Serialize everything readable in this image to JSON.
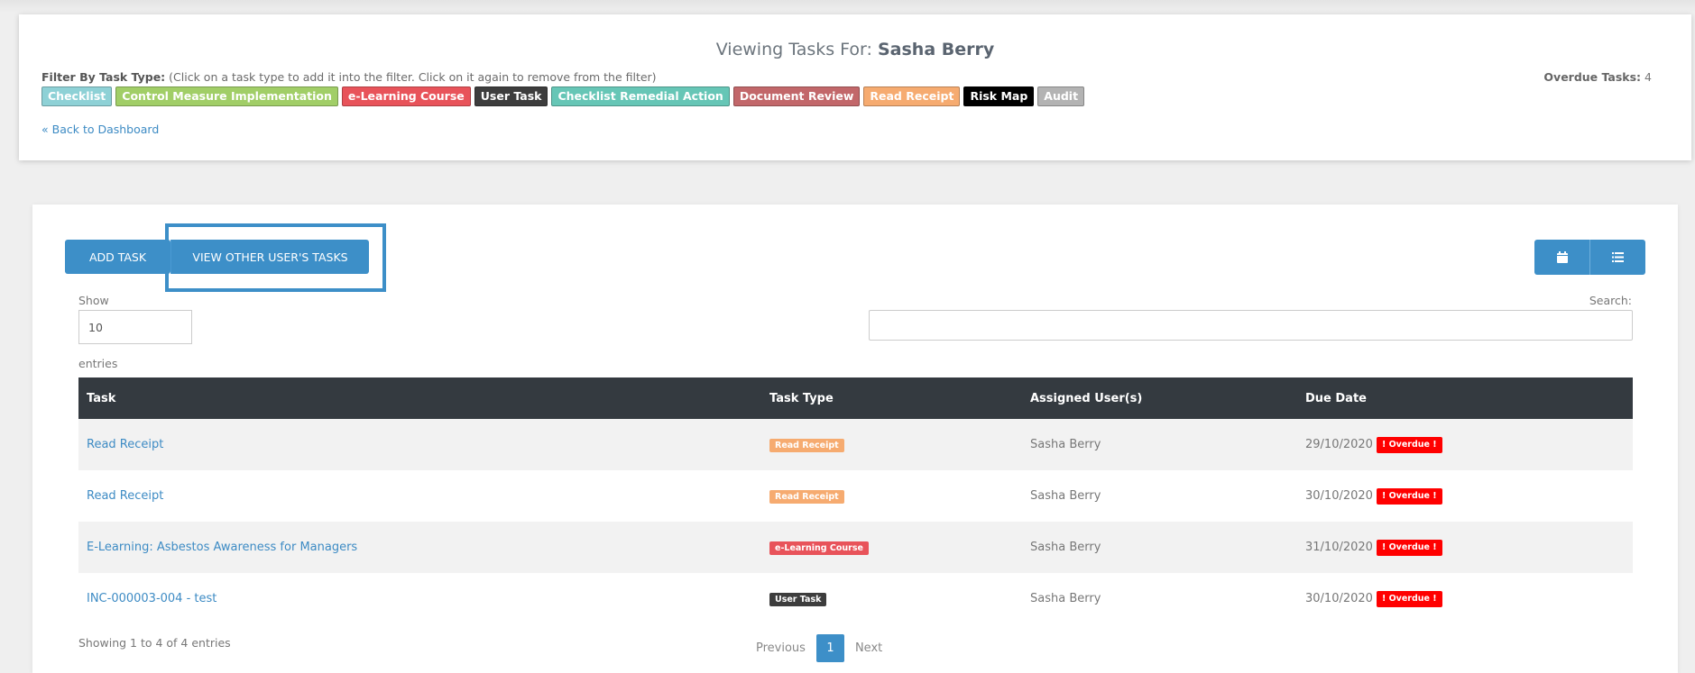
{
  "header": {
    "viewing_prefix": "Viewing Tasks For:",
    "viewing_user": "Sasha Berry",
    "filter_label": "Filter By Task Type:",
    "filter_hint": "(Click on a task type to add it into the filter. Click on it again to remove from the filter)",
    "overdue_label": "Overdue Tasks:",
    "overdue_value": "4",
    "back_link": "« Back to Dashboard",
    "chips": [
      {
        "label": "Checklist",
        "color": "#8ed1d6"
      },
      {
        "label": "Control Measure Implementation",
        "color": "#a1ce67"
      },
      {
        "label": "e-Learning Course",
        "color": "#e8535a"
      },
      {
        "label": "User Task",
        "color": "#3d3d3d"
      },
      {
        "label": "Checklist Remedial Action",
        "color": "#66c6b6"
      },
      {
        "label": "Document Review",
        "color": "#c2676a"
      },
      {
        "label": "Read Receipt",
        "color": "#f6ab70"
      },
      {
        "label": "Risk Map",
        "color": "#000000"
      },
      {
        "label": "Audit",
        "color": "#b3b3b3"
      }
    ]
  },
  "toolbar": {
    "add_task": "ADD TASK",
    "view_others": "VIEW OTHER USER'S TASKS",
    "calendar_icon": "calendar-icon",
    "list_icon": "list-icon"
  },
  "table_controls": {
    "show_label": "Show",
    "show_value": "10",
    "entries_label": "entries",
    "search_label": "Search:"
  },
  "table": {
    "headers": [
      "Task",
      "Task Type",
      "Assigned User(s)",
      "Due Date"
    ],
    "rows": [
      {
        "task": "Read Receipt",
        "type": "Read Receipt",
        "type_color": "#f6ab70",
        "user": "Sasha Berry",
        "due": "29/10/2020",
        "overdue": "! Overdue !"
      },
      {
        "task": "Read Receipt",
        "type": "Read Receipt",
        "type_color": "#f6ab70",
        "user": "Sasha Berry",
        "due": "30/10/2020",
        "overdue": "! Overdue !"
      },
      {
        "task": "E-Learning: Asbestos Awareness for Managers",
        "type": "e-Learning Course",
        "type_color": "#e8535a",
        "user": "Sasha Berry",
        "due": "31/10/2020",
        "overdue": "! Overdue !"
      },
      {
        "task": "INC-000003-004 - test",
        "type": "User Task",
        "type_color": "#3d3d3d",
        "user": "Sasha Berry",
        "due": "30/10/2020",
        "overdue": "! Overdue !"
      }
    ]
  },
  "footer": {
    "showing": "Showing 1 to 4 of 4 entries",
    "previous": "Previous",
    "page": "1",
    "next": "Next"
  }
}
